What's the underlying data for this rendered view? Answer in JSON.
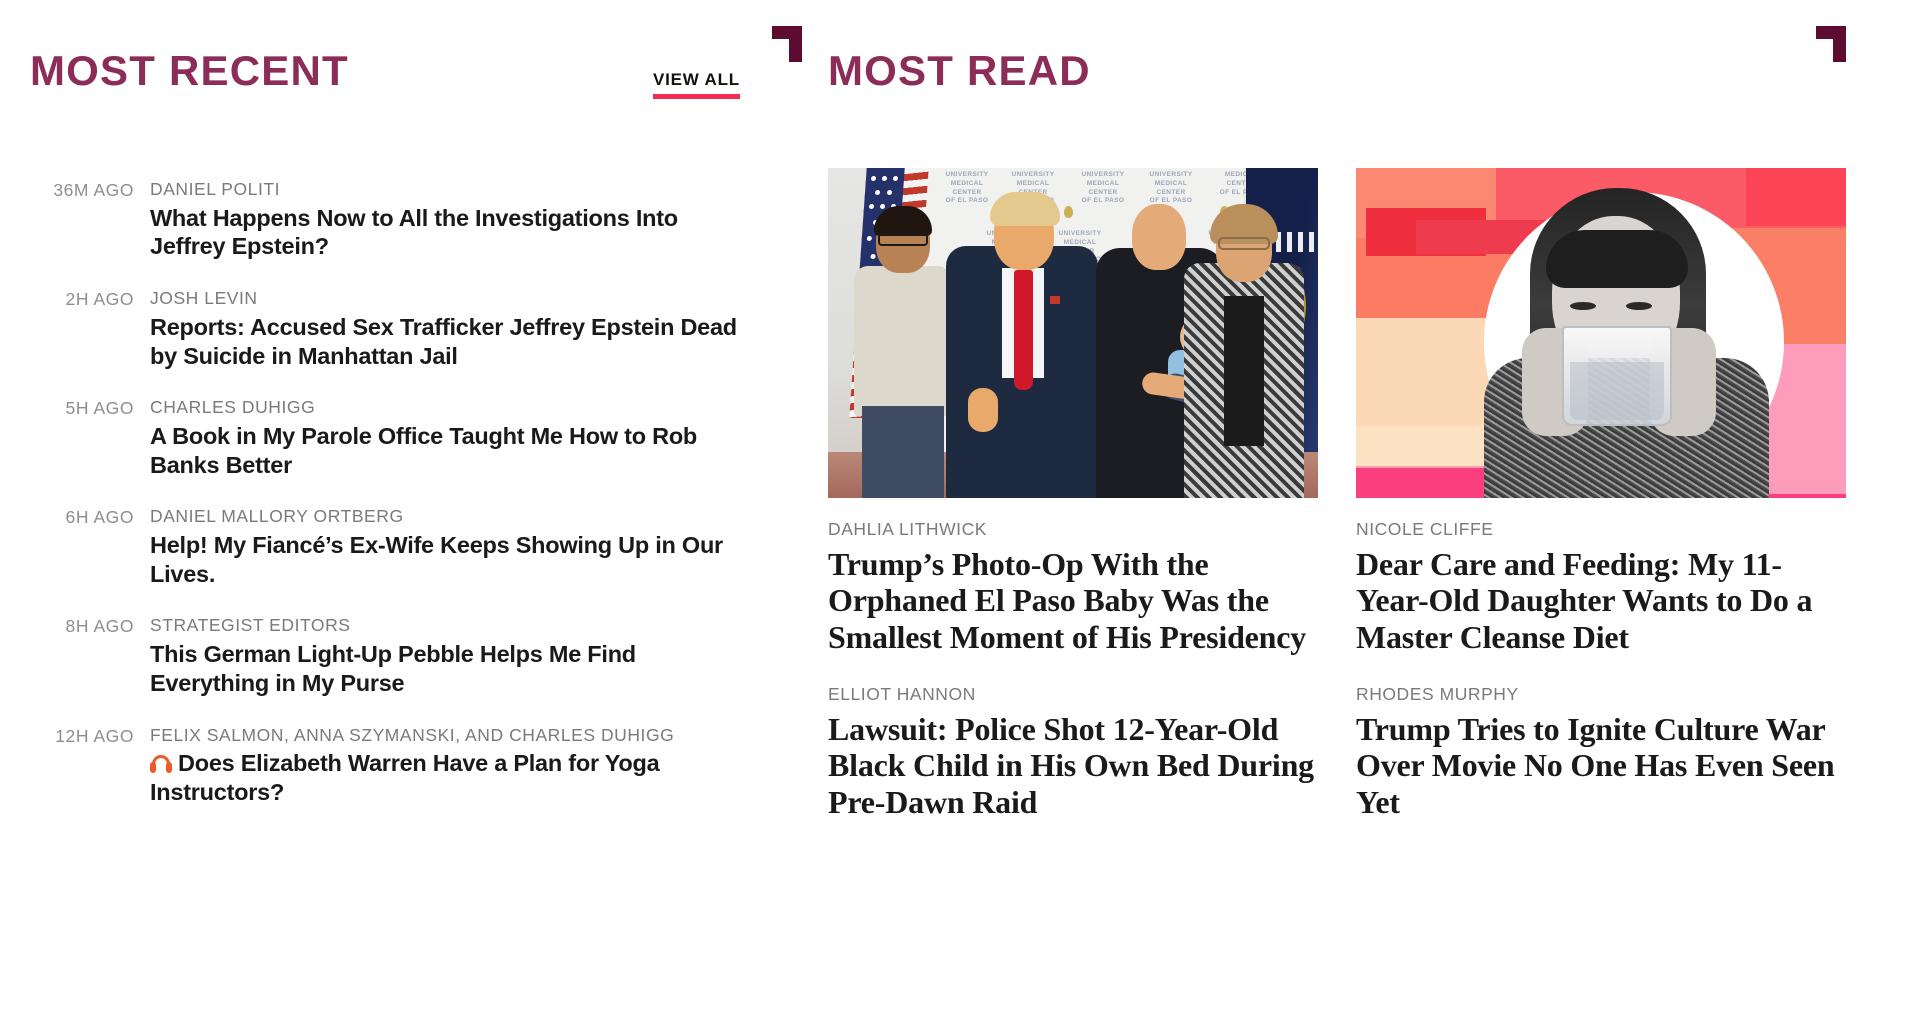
{
  "most_recent": {
    "title": "MOST RECENT",
    "view_all_label": "VIEW ALL",
    "items": [
      {
        "time": "36M AGO",
        "author": "DANIEL POLITI",
        "headline": "What Happens Now to All the Investigations Into Jeffrey Epstein?",
        "has_audio": false
      },
      {
        "time": "2H AGO",
        "author": "JOSH LEVIN",
        "headline": "Reports: Accused Sex Trafficker Jeffrey Epstein Dead by Suicide in Manhattan Jail",
        "has_audio": false
      },
      {
        "time": "5H AGO",
        "author": "CHARLES DUHIGG",
        "headline": "A Book in My Parole Office Taught Me How to Rob Banks Better",
        "has_audio": false
      },
      {
        "time": "6H AGO",
        "author": "DANIEL MALLORY ORTBERG",
        "headline": "Help! My Fiancé’s Ex-Wife Keeps Showing Up in Our Lives.",
        "has_audio": false
      },
      {
        "time": "8H AGO",
        "author": "STRATEGIST EDITORS",
        "headline": "This German Light-Up Pebble Helps Me Find Everything in My Purse",
        "has_audio": false
      },
      {
        "time": "12H AGO",
        "author": "FELIX SALMON, ANNA SZYMANSKI, AND CHARLES DUHIGG",
        "headline": "Does Elizabeth Warren Have a Plan for Yoga Instructors?",
        "has_audio": true,
        "audio_icon": "headphones-icon"
      }
    ]
  },
  "most_read": {
    "title": "MOST READ",
    "items": [
      {
        "author": "DAHLIA LITHWICK",
        "headline": "Trump’s Photo-Op With the Orphaned El Paso Baby Was the Smallest Moment of His Presidency",
        "thumb": "trump-melania-el-paso-baby-photo",
        "thumb_overlay_text": "UNIVERSITY MEDICAL CENTER OF EL PASO"
      },
      {
        "author": "NICOLE CLIFFE",
        "headline": "Dear Care and Feeding: My 11-Year-Old Daughter Wants to Do a Master Cleanse Diet",
        "thumb": "girl-drinking-glass-of-water-collage",
        "thumb_overlay_text": ""
      },
      {
        "author": "ELLIOT HANNON",
        "headline": "Lawsuit: Police Shot 12-Year-Old Black Child in His Own Bed During Pre-Dawn Raid",
        "thumb": null,
        "thumb_overlay_text": ""
      },
      {
        "author": "RHODES MURPHY",
        "headline": "Trump Tries to Ignite Culture War Over Movie No One Has Even Seen Yet",
        "thumb": null,
        "thumb_overlay_text": ""
      }
    ]
  },
  "decor": {
    "bracket_left": "corner-bracket-mark",
    "bracket_right": "corner-bracket-mark"
  },
  "colors": {
    "section_title": "#8c2c58",
    "accent_underline": "#f62d53",
    "bracket": "#5e0b32",
    "meta_text": "#7a7a7a",
    "headline_text": "#1a1a1a",
    "audio_icon": "#f05a28"
  }
}
